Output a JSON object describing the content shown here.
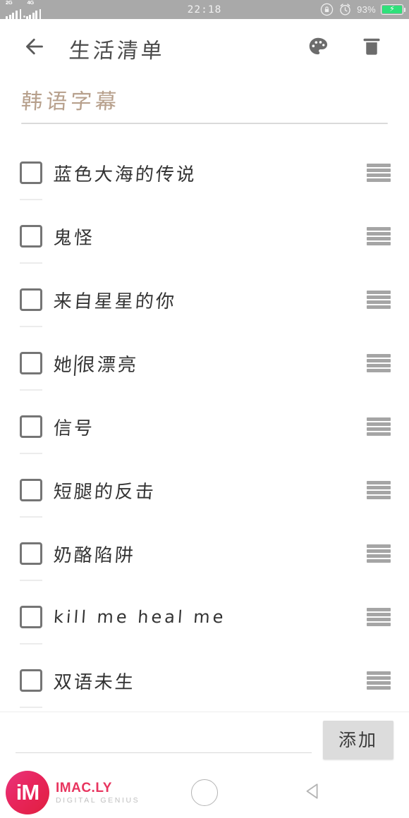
{
  "statusbar": {
    "time": "22:18",
    "network_left": "2G",
    "network_right": "4G",
    "battery_percent": "93%",
    "icons": {
      "rotation_lock": "rotation-lock-icon",
      "alarm": "alarm-clock-icon",
      "battery": "battery-charging-icon",
      "signal": "signal-bars-icon"
    },
    "bg_color": "#a9a9a9"
  },
  "header": {
    "title": "生活清单",
    "back_icon": "arrow-left-icon",
    "palette_icon": "palette-icon",
    "delete_icon": "trash-icon"
  },
  "note": {
    "title": "韩语字幕",
    "title_placeholder": "标题",
    "title_color": "#b7a08c"
  },
  "items": [
    {
      "label": "蓝色大海的传说",
      "checked": false,
      "latin": false,
      "caret": -1
    },
    {
      "label": "鬼怪",
      "checked": false,
      "latin": false,
      "caret": -1
    },
    {
      "label": "来自星星的你",
      "checked": false,
      "latin": false,
      "caret": -1
    },
    {
      "label": "她很漂亮",
      "checked": false,
      "latin": false,
      "caret": 1
    },
    {
      "label": "信号",
      "checked": false,
      "latin": false,
      "caret": -1
    },
    {
      "label": "短腿的反击",
      "checked": false,
      "latin": false,
      "caret": -1
    },
    {
      "label": "奶酪陷阱",
      "checked": false,
      "latin": false,
      "caret": -1
    },
    {
      "label": "kill me heal me",
      "checked": false,
      "latin": true,
      "caret": -1
    },
    {
      "label": "双语未生",
      "checked": false,
      "latin": false,
      "caret": -1
    }
  ],
  "add_bar": {
    "input_value": "",
    "input_placeholder": "",
    "button_label": "添加"
  },
  "watermark": {
    "logo_text": "iM",
    "name": "IMAC.LY",
    "tagline": "DIGITAL GENIUS",
    "brand_color": "#e8355f"
  },
  "navbar": {
    "home_icon": "home-circle-icon",
    "back_icon": "back-triangle-icon"
  }
}
